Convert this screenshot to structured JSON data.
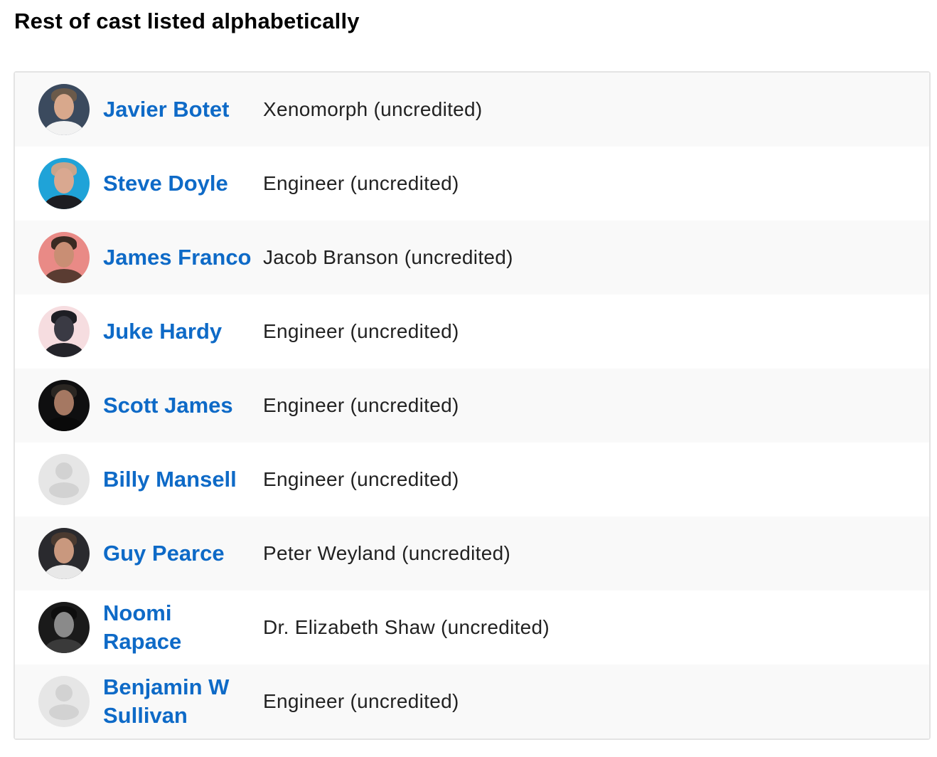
{
  "heading": "Rest of cast listed alphabetically",
  "cast": [
    {
      "name": "Javier Botet",
      "role": "Xenomorph (uncredited)"
    },
    {
      "name": "Steve Doyle",
      "role": "Engineer (uncredited)"
    },
    {
      "name": "James Franco",
      "role": "Jacob Branson (uncredited)"
    },
    {
      "name": "Juke Hardy",
      "role": "Engineer (uncredited)"
    },
    {
      "name": "Scott James",
      "role": "Engineer (uncredited)"
    },
    {
      "name": "Billy Mansell",
      "role": "Engineer (uncredited)"
    },
    {
      "name": "Guy Pearce",
      "role": "Peter Weyland (uncredited)"
    },
    {
      "name": "Noomi Rapace",
      "role": "Dr. Elizabeth Shaw (uncredited)"
    },
    {
      "name": "Benjamin W Sullivan",
      "role": "Engineer (uncredited)"
    }
  ],
  "colors": {
    "link": "#0e6ac7",
    "row_alt": "#f9f9f9",
    "border": "#e4e4e4"
  }
}
